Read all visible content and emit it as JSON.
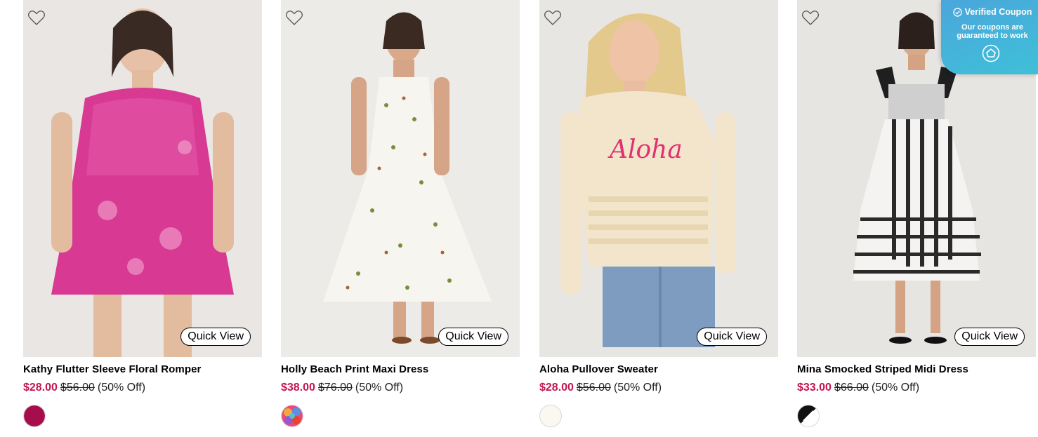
{
  "products": [
    {
      "title": "Kathy Flutter Sleeve Floral Romper",
      "sale_price": "$28.00",
      "original_price": "$56.00",
      "discount": "(50% Off)",
      "quick_view_label": "Quick View",
      "swatch_color": "#a50d4d"
    },
    {
      "title": "Holly Beach Print Maxi Dress",
      "sale_price": "$38.00",
      "original_price": "$76.00",
      "discount": "(50% Off)",
      "quick_view_label": "Quick View",
      "swatch_color": "multicolor"
    },
    {
      "title": "Aloha Pullover Sweater",
      "sale_price": "$28.00",
      "original_price": "$56.00",
      "discount": "(50% Off)",
      "quick_view_label": "Quick View",
      "swatch_color": "#fbf8ef"
    },
    {
      "title": "Mina Smocked Striped Midi Dress",
      "sale_price": "$33.00",
      "original_price": "$66.00",
      "discount": "(50% Off)",
      "quick_view_label": "Quick View",
      "swatch_color": "black-white"
    }
  ],
  "coupon_badge": {
    "title": "Verified Coupon",
    "subtitle_line1": "Our coupons are",
    "subtitle_line2": "guaranteed to work"
  },
  "colors": {
    "sale_price": "#c4164f",
    "coupon_gradient_start": "#4aa6db",
    "coupon_gradient_end": "#3fc0d8"
  }
}
